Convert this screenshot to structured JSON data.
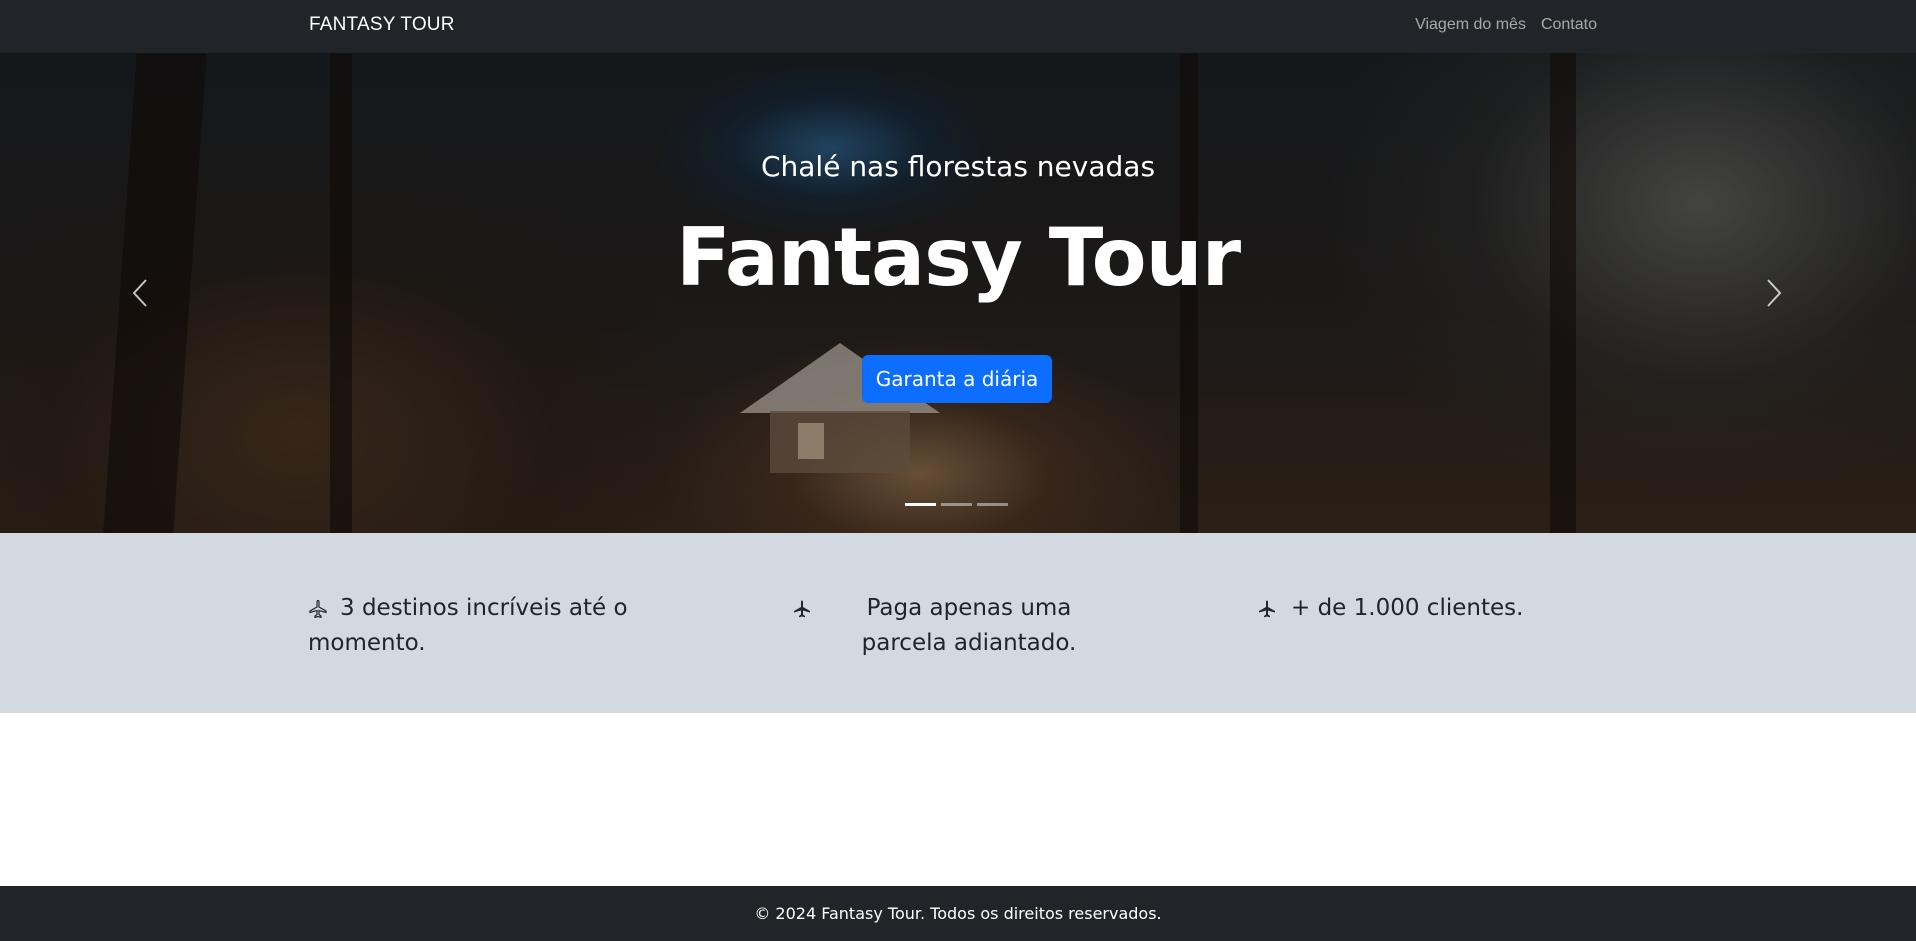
{
  "navbar": {
    "brand": "FANTASY TOUR",
    "links": [
      "Viagem do mês",
      "Contato"
    ]
  },
  "hero": {
    "subtitle": "Chalé nas florestas nevadas",
    "title": "Fantasy Tour",
    "cta_label": "Garanta a diária",
    "slide_count": 3,
    "active_slide": 1
  },
  "features": [
    {
      "icon": "airplane-outline-icon",
      "text": "3 destinos incríveis até o momento."
    },
    {
      "icon": "airplane-icon",
      "text": "Paga apenas uma parcela adiantado."
    },
    {
      "icon": "airplane-icon",
      "text": "+ de 1.000 clientes."
    }
  ],
  "footer": {
    "text": "© 2024 Fantasy Tour. Todos os direitos reservados."
  },
  "colors": {
    "navbar_bg": "#212529",
    "primary": "#0d6efd",
    "features_bg": "#d3d9e0"
  }
}
